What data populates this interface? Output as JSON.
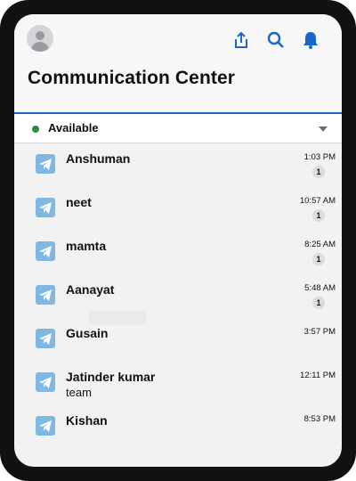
{
  "header": {
    "title": "Communication Center",
    "icons": [
      "avatar",
      "share-icon",
      "search-icon",
      "bell-icon"
    ],
    "accent_color": "#1a66c9"
  },
  "status": {
    "label": "Available",
    "color": "#2e8b3a"
  },
  "conversations": [
    {
      "name": "Anshuman",
      "subtitle": "",
      "time": "1:03 PM",
      "unread": "1"
    },
    {
      "name": "neet",
      "subtitle": "",
      "time": "10:57 AM",
      "unread": "1"
    },
    {
      "name": "mamta",
      "subtitle": "",
      "time": "8:25 AM",
      "unread": "1"
    },
    {
      "name": "Aanayat",
      "subtitle": "",
      "time": "5:48 AM",
      "unread": "1"
    },
    {
      "name": "Gusain",
      "subtitle": "",
      "time": "3:57 PM",
      "unread": ""
    },
    {
      "name": "Jatinder kumar",
      "subtitle": "team",
      "time": "12:11 PM",
      "unread": ""
    },
    {
      "name": "Kishan",
      "subtitle": "",
      "time": "8:53 PM",
      "unread": ""
    }
  ],
  "channel_icon": "telegram-icon"
}
